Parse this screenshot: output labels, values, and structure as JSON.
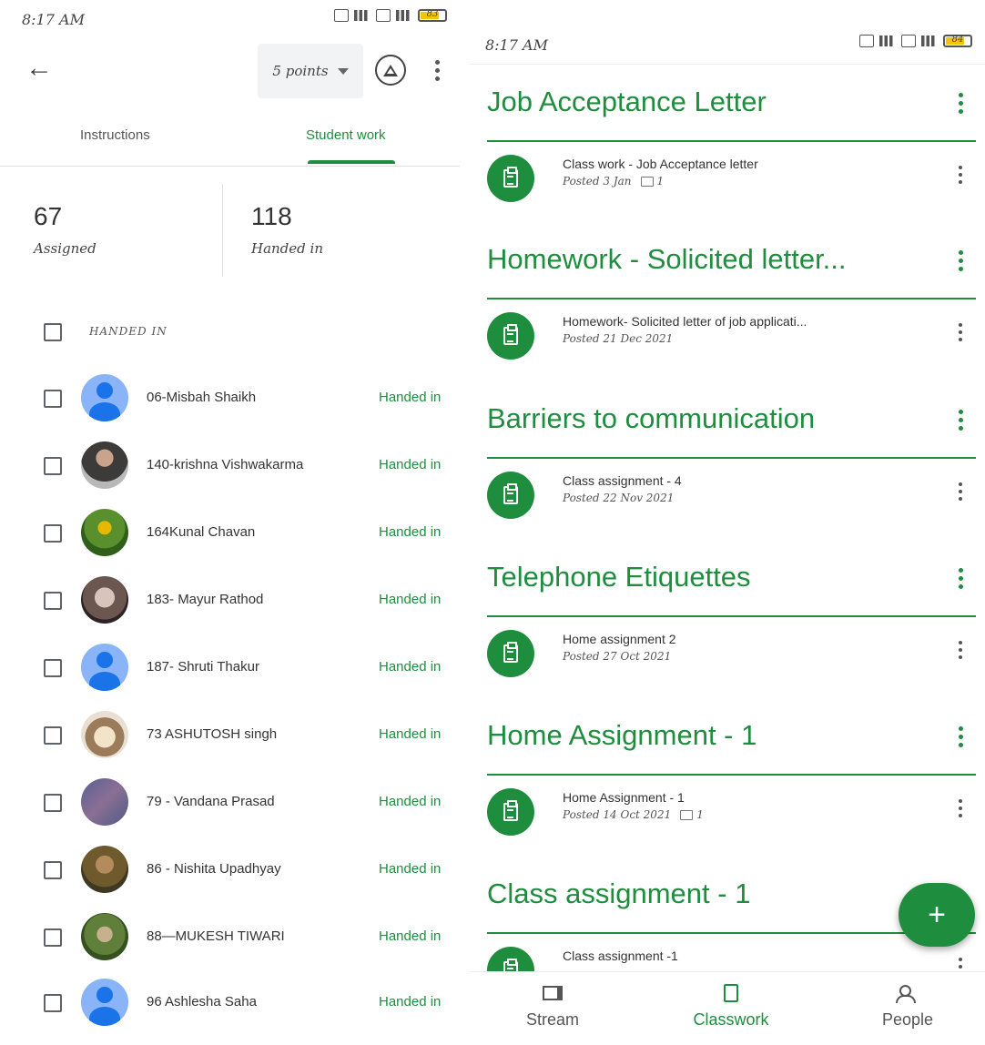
{
  "left": {
    "status": {
      "time": "8:17 AM",
      "battery": "83"
    },
    "toolbar": {
      "points_label": "5 points"
    },
    "tabs": [
      {
        "label": "Instructions"
      },
      {
        "label": "Student work"
      }
    ],
    "stats": {
      "assigned_count": "67",
      "assigned_label": "Assigned",
      "handed_count": "118",
      "handed_label": "Handed in"
    },
    "section_header": "HANDED IN",
    "students": [
      {
        "name": "06-Misbah Shaikh",
        "status": "Handed in",
        "avatar": "default"
      },
      {
        "name": "140-krishna Vishwakarma",
        "status": "Handed in",
        "avatar": "photo"
      },
      {
        "name": "164Kunal Chavan",
        "status": "Handed in",
        "avatar": "photo"
      },
      {
        "name": "183- Mayur Rathod",
        "status": "Handed in",
        "avatar": "photo"
      },
      {
        "name": "187- Shruti Thakur",
        "status": "Handed in",
        "avatar": "default"
      },
      {
        "name": "73 ASHUTOSH singh",
        "status": "Handed in",
        "avatar": "photo"
      },
      {
        "name": "79 - Vandana Prasad",
        "status": "Handed in",
        "avatar": "photo"
      },
      {
        "name": "86 - Nishita Upadhyay",
        "status": "Handed in",
        "avatar": "photo"
      },
      {
        "name": "88—MUKESH TIWARI",
        "status": "Handed in",
        "avatar": "photo"
      },
      {
        "name": "96 Ashlesha Saha",
        "status": "Handed in",
        "avatar": "default"
      }
    ]
  },
  "right": {
    "status": {
      "time": "8:17 AM",
      "battery": "84"
    },
    "topics": [
      {
        "title": "Job Acceptance Letter",
        "item": {
          "title": "Class work - Job Acceptance letter",
          "posted": "Posted 3 Jan",
          "comments": "1"
        }
      },
      {
        "title": "Homework - Solicited letter...",
        "item": {
          "title": "Homework- Solicited letter of job applicati...",
          "posted": "Posted 21 Dec 2021",
          "comments": ""
        }
      },
      {
        "title": "Barriers to communication",
        "item": {
          "title": "Class assignment - 4",
          "posted": "Posted 22 Nov 2021",
          "comments": ""
        }
      },
      {
        "title": "Telephone Etiquettes",
        "item": {
          "title": "Home assignment 2",
          "posted": "Posted 27 Oct 2021",
          "comments": ""
        }
      },
      {
        "title": "Home Assignment - 1",
        "item": {
          "title": "Home Assignment - 1",
          "posted": "Posted 14 Oct 2021",
          "comments": "1"
        }
      },
      {
        "title": "Class assignment - 1",
        "item": {
          "title": "Class assignment -1",
          "posted": "",
          "comments": ""
        }
      }
    ],
    "fab_label": "+",
    "bottom_nav": [
      {
        "label": "Stream"
      },
      {
        "label": "Classwork"
      },
      {
        "label": "People"
      }
    ]
  }
}
